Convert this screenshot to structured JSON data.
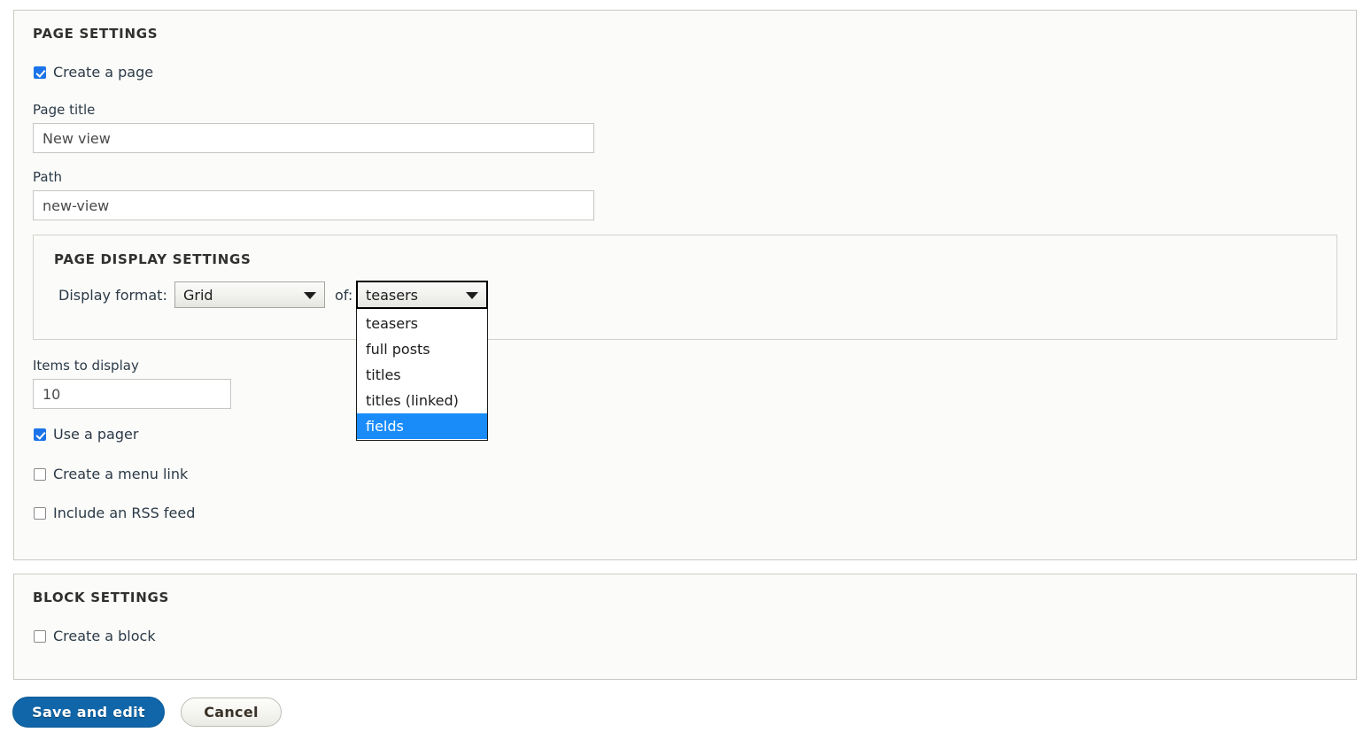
{
  "page_settings": {
    "legend": "Page settings",
    "create_page": {
      "label": "Create a page",
      "checked": true
    },
    "page_title": {
      "label": "Page title",
      "value": "New view"
    },
    "path": {
      "label": "Path",
      "value": "new-view"
    },
    "display_settings": {
      "legend": "Page display settings",
      "display_format_label": "Display format:",
      "format_value": "Grid",
      "of_label": "of:",
      "of_value": "teasers",
      "of_options": [
        "teasers",
        "full posts",
        "titles",
        "titles (linked)",
        "fields"
      ],
      "of_selected": "fields",
      "dropdown_open": true
    },
    "items_to_display": {
      "label": "Items to display",
      "value": "10"
    },
    "use_pager": {
      "label": "Use a pager",
      "checked": true
    },
    "create_menu_link": {
      "label": "Create a menu link",
      "checked": false
    },
    "include_rss": {
      "label": "Include an RSS feed",
      "checked": false
    }
  },
  "block_settings": {
    "legend": "Block settings",
    "create_block": {
      "label": "Create a block",
      "checked": false
    }
  },
  "actions": {
    "save_label": "Save and edit",
    "cancel_label": "Cancel"
  },
  "colors": {
    "accent_blue": "#1066a8",
    "checkbox_blue": "#1a73e8",
    "highlight_blue": "#1a8cfa",
    "panel_bg": "#fbfbf9",
    "panel_border": "#c9c9c4",
    "text": "#2b3a47"
  }
}
